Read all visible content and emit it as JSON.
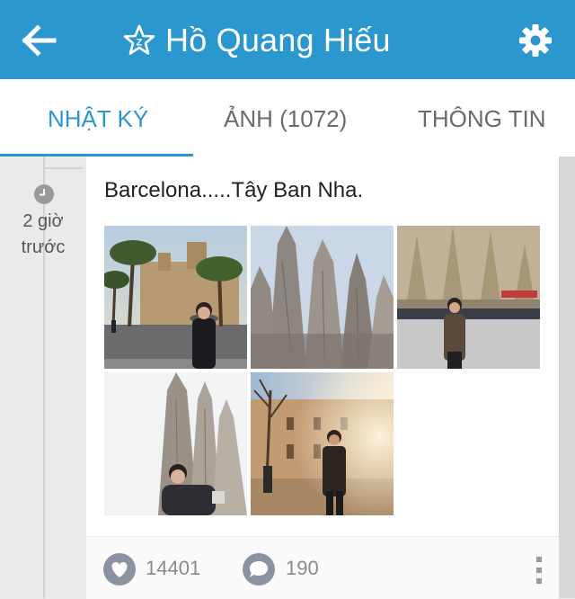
{
  "header": {
    "title": "Hồ Quang Hiếu",
    "back_icon": "arrow-left-icon",
    "badge_icon": "star-icon",
    "settings_icon": "gear-icon",
    "color": "#2a97cf"
  },
  "tabs": [
    {
      "label": "NHẬT KÝ",
      "active": true
    },
    {
      "label": "ẢNH (1072)",
      "active": false
    },
    {
      "label": "THÔNG TIN",
      "active": false
    }
  ],
  "post": {
    "time_line1": "2 giờ",
    "time_line2": "trước",
    "text": "Barcelona.....Tây Ban Nha.",
    "photos": [
      {
        "name": "photo-palm-street"
      },
      {
        "name": "photo-sagrada-spires"
      },
      {
        "name": "photo-sagrada-facade-crowd"
      },
      {
        "name": "photo-sagrada-selfie"
      },
      {
        "name": "photo-street-sunset"
      }
    ],
    "likes": "14401",
    "comments": "190"
  }
}
